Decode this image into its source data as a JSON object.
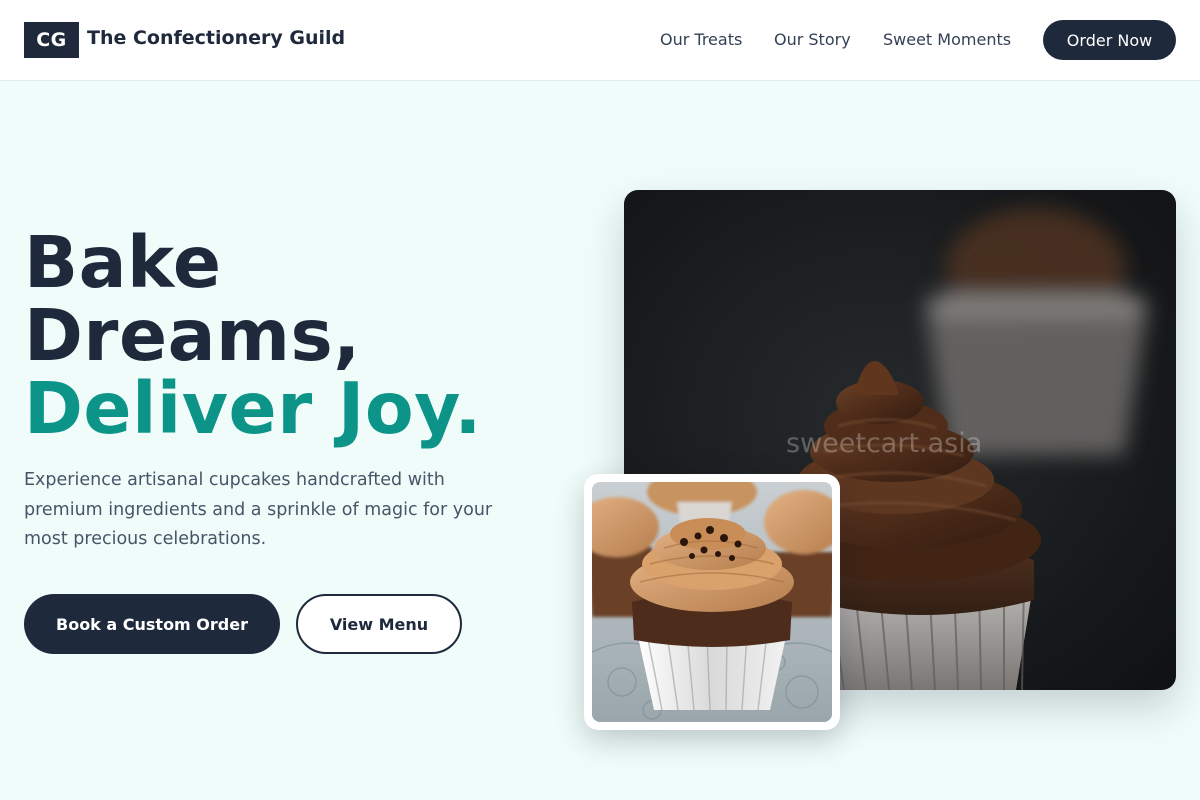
{
  "header": {
    "logo_mark": "CG",
    "brand_name": "The Confectionery Guild",
    "nav": [
      {
        "label": "Our Treats"
      },
      {
        "label": "Our Story"
      },
      {
        "label": "Sweet Moments"
      }
    ],
    "cta_label": "Order Now"
  },
  "hero": {
    "headline_line1": "Bake",
    "headline_line2": "Dreams,",
    "headline_accent": "Deliver Joy.",
    "subtext": "Experience artisanal cupcakes handcrafted with premium ingredients and a sprinkle of magic for your most precious celebrations.",
    "primary_button": "Book a Custom Order",
    "secondary_button": "View Menu"
  },
  "images": {
    "main_watermark": "sweetcart.asia",
    "main_photo_icon": "chocolate-cupcake-photo",
    "small_photo_icon": "caramel-cupcakes-photo"
  },
  "colors": {
    "navy": "#1e293b",
    "teal_accent": "#0d9488",
    "hero_background": "#effcf9",
    "body_text": "#475569"
  }
}
